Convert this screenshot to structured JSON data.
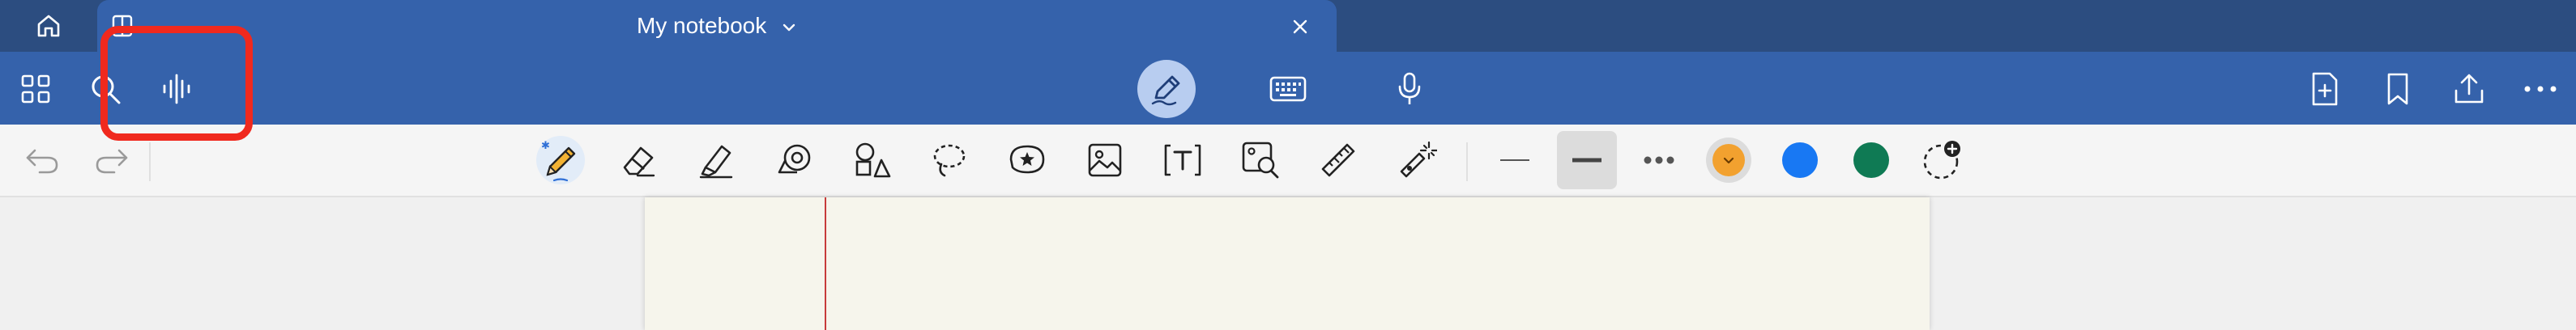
{
  "tab": {
    "title": "My notebook"
  },
  "colors": {
    "tabbar": "#2c4d80",
    "ribbon": "#3562ab",
    "pen_active": "#b8cdf0",
    "paper": "#f6f5ec",
    "margin_line": "#c73b3b",
    "annotation": "#f0291e"
  },
  "ribbon": {
    "left_icons": [
      "apps-grid-icon",
      "search-icon",
      "voice-waveform-icon"
    ],
    "modes": [
      "pen-mode-icon",
      "keyboard-icon",
      "microphone-icon"
    ],
    "right_icons": [
      "add-page-icon",
      "bookmark-icon",
      "share-icon",
      "more-icon"
    ]
  },
  "toolbar": {
    "history": [
      "undo-icon",
      "redo-icon"
    ],
    "tools": [
      "pencil-icon",
      "eraser-icon",
      "highlighter-icon",
      "tape-icon",
      "shapes-icon",
      "lasso-icon",
      "sticker-icon",
      "image-icon",
      "textbox-icon",
      "image-search-icon",
      "ruler-icon",
      "laser-pointer-icon"
    ],
    "strokes": [
      "thin-line-icon",
      "thick-line-icon",
      "dotted-line-icon"
    ],
    "palette": [
      {
        "name": "orange",
        "hex": "#f2a12f"
      },
      {
        "name": "blue",
        "hex": "#1878f3"
      },
      {
        "name": "green",
        "hex": "#0f7a54"
      }
    ]
  }
}
